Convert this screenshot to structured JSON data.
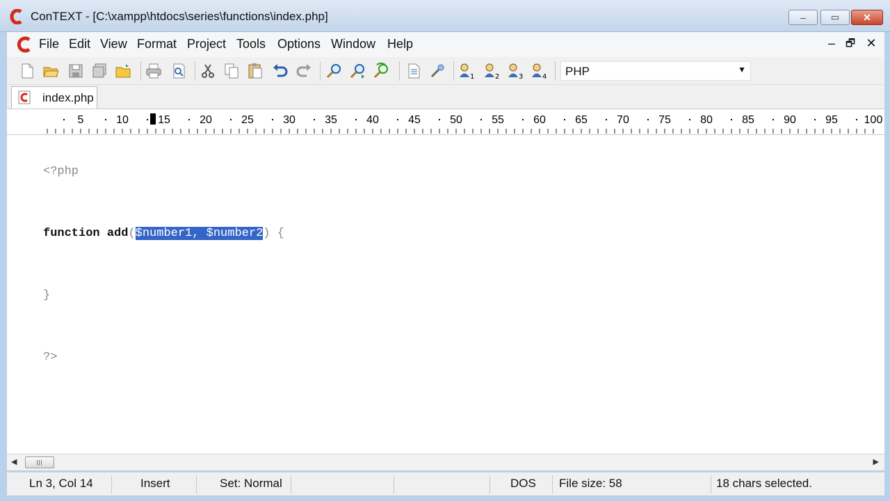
{
  "window": {
    "title": "ConTEXT - [C:\\xampp\\htdocs\\series\\functions\\index.php]",
    "min_glyph": "–",
    "max_glyph": "▭",
    "close_glyph": "✕"
  },
  "menu": {
    "items": [
      "File",
      "Edit",
      "View",
      "Format",
      "Project",
      "Tools",
      "Options",
      "Window",
      "Help"
    ],
    "mdi_min": "–",
    "mdi_restore": "🗗",
    "mdi_close": "✕"
  },
  "toolbar": {
    "icons": [
      "new-file-icon",
      "open-file-icon",
      "save-icon",
      "save-all-icon",
      "open-folder-icon",
      "print-icon",
      "print-preview-icon",
      "cut-icon",
      "copy-icon",
      "paste-icon",
      "undo-icon",
      "redo-icon",
      "find-icon",
      "find-next-icon",
      "replace-icon",
      "document-properties-icon",
      "tools-icon",
      "user-command-1-icon",
      "user-command-2-icon",
      "user-command-3-icon",
      "user-command-4-icon"
    ],
    "language": "PHP"
  },
  "tabs": [
    {
      "label": "index.php",
      "active": true
    }
  ],
  "ruler": {
    "labels": [
      "5",
      "10",
      "15",
      "20",
      "25",
      "30",
      "35",
      "40",
      "45",
      "50",
      "55",
      "60",
      "65",
      "70",
      "75",
      "80",
      "85",
      "90",
      "95",
      "100"
    ]
  },
  "editor": {
    "lines": [
      {
        "text": "<?php"
      },
      {
        "keyword": "function",
        "before": " add",
        "open_paren": "(",
        "selected": "$number1, $number2",
        "after": ") {"
      },
      {
        "text": "}"
      },
      {
        "text": "?>"
      }
    ]
  },
  "status": {
    "position": "Ln 3, Col 14",
    "mode": "Insert",
    "set": "Set: Normal",
    "line_endings": "DOS",
    "file_size": "File size: 58",
    "selection": "18 chars selected."
  },
  "colors": {
    "selection": "#3465c7",
    "title_bar": "#c3d5ea",
    "close_button": "#c9442a",
    "app_logo": "#d42a1c"
  }
}
